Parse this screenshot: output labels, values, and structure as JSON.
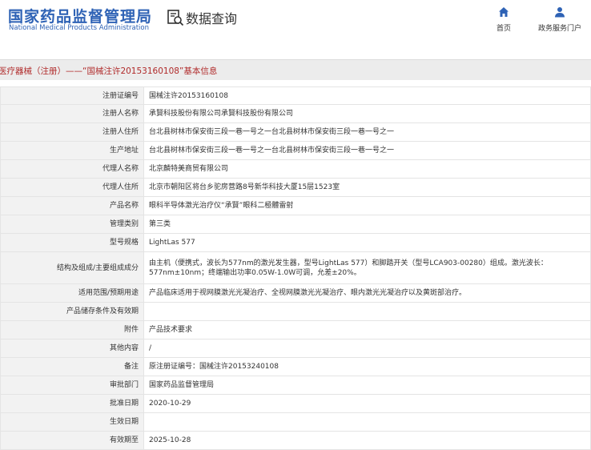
{
  "header": {
    "logo_cn": "国家药品监督管理局",
    "logo_en": "National Medical Products Administration",
    "section_title": "数据查询",
    "nav": [
      {
        "label": "首页",
        "icon": "home-icon"
      },
      {
        "label": "政务服务门户",
        "icon": "user-icon"
      }
    ]
  },
  "colors": {
    "brand_blue": "#2e62b5",
    "title_red": "#b02a2a",
    "label_bg": "#f2f2f2"
  },
  "page_title": "医疗器械（注册）——“国械注许20153160108”基本信息",
  "fields": [
    {
      "label": "注册证编号",
      "value": "国械注许20153160108"
    },
    {
      "label": "注册人名称",
      "value": "承賢科技股份有限公司承賢科技股份有限公司"
    },
    {
      "label": "注册人住所",
      "value": "台北县树林市保安街三段一巷一号之一台北县树林市保安街三段一巷一号之一"
    },
    {
      "label": "生产地址",
      "value": "台北县树林市保安街三段一巷一号之一台北县树林市保安街三段一巷一号之一"
    },
    {
      "label": "代理人名称",
      "value": "北京麟特美商贸有限公司"
    },
    {
      "label": "代理人住所",
      "value": "北京市朝阳区将台乡驼房营路8号新华科技大厦15层1523室"
    },
    {
      "label": "产品名称",
      "value": "眼科半导体激光治疗仪“承賢”眼科二極體雷射"
    },
    {
      "label": "管理类别",
      "value": "第三类"
    },
    {
      "label": "型号规格",
      "value": "LightLas 577"
    },
    {
      "label": "结构及组成/主要组成成分",
      "value": "由主机（便携式，波长为577nm的激光发生器，型号LightLas 577）和脚踏开关（型号LCA903-00280）组成。激光波长：577nm±10nm；终端输出功率0.05W-1.0W可调，允差±20%。"
    },
    {
      "label": "适用范围/预期用途",
      "value": "产品临床适用于视网膜激光光凝治疗、全视网膜激光光凝治疗、眼内激光光凝治疗以及黄斑部治疗。"
    },
    {
      "label": "产品储存条件及有效期",
      "value": ""
    },
    {
      "label": "附件",
      "value": "产品技术要求"
    },
    {
      "label": "其他内容",
      "value": "/"
    },
    {
      "label": "备注",
      "value": "原注册证编号：国械注许20153240108"
    },
    {
      "label": "审批部门",
      "value": "国家药品监督管理局"
    },
    {
      "label": "批准日期",
      "value": "2020-10-29"
    },
    {
      "label": "生效日期",
      "value": ""
    },
    {
      "label": "有效期至",
      "value": "2025-10-28"
    }
  ]
}
